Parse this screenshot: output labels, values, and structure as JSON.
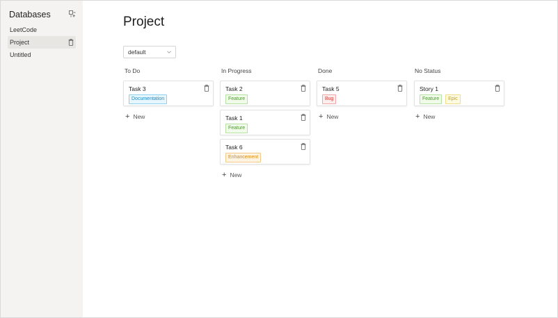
{
  "sidebar": {
    "title": "Databases",
    "items": [
      {
        "label": "LeetCode"
      },
      {
        "label": "Project"
      },
      {
        "label": "Untitled"
      }
    ]
  },
  "main": {
    "title": "Project",
    "view": {
      "selected": "default"
    }
  },
  "columns": [
    {
      "title": "To Do",
      "cards": [
        {
          "title": "Task 3",
          "tags": [
            {
              "label": "Documentation",
              "color": "#1e88c7"
            }
          ]
        }
      ],
      "new_label": "New"
    },
    {
      "title": "In Progress",
      "cards": [
        {
          "title": "Task 2",
          "tags": [
            {
              "label": "Feature",
              "color": "#4b9a2b"
            }
          ]
        },
        {
          "title": "Task 1",
          "tags": [
            {
              "label": "Feature",
              "color": "#4b9a2b"
            }
          ]
        },
        {
          "title": "Task 6",
          "tags": [
            {
              "label": "Enhancement",
              "color": "#d98a14"
            }
          ]
        }
      ],
      "new_label": "New"
    },
    {
      "title": "Done",
      "cards": [
        {
          "title": "Task 5",
          "tags": [
            {
              "label": "Bug",
              "color": "#cf3b3b"
            }
          ]
        }
      ],
      "new_label": "New"
    },
    {
      "title": "No Status",
      "cards": [
        {
          "title": "Story 1",
          "tags": [
            {
              "label": "Feature",
              "color": "#4b9a2b"
            },
            {
              "label": "Epic",
              "color": "#c9a100"
            }
          ]
        }
      ],
      "new_label": "New"
    }
  ]
}
